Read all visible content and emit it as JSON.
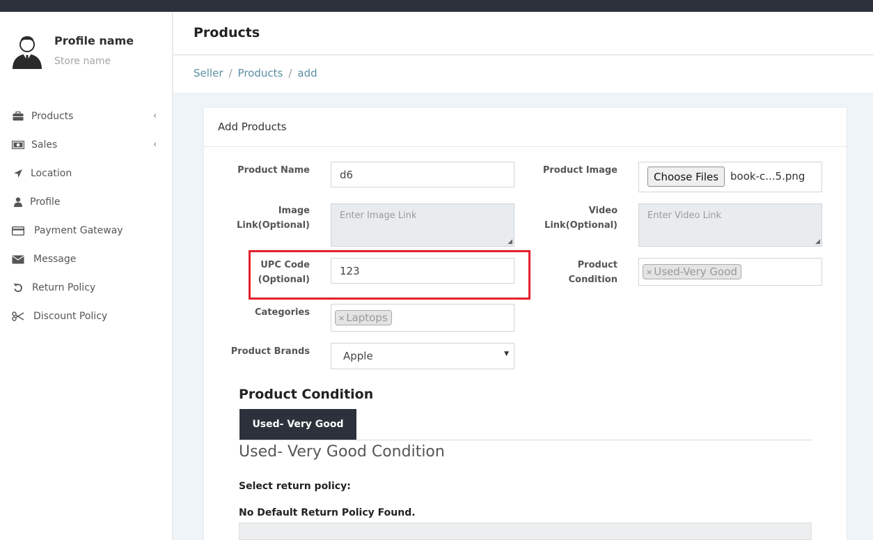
{
  "sidebar": {
    "profile_name": "Profile name",
    "store_name": "Store name",
    "items": [
      {
        "label": "Products",
        "icon": "briefcase-icon",
        "has_chevron": true
      },
      {
        "label": "Sales",
        "icon": "money-icon",
        "has_chevron": true
      },
      {
        "label": "Location",
        "icon": "location-arrow-icon",
        "has_chevron": false
      },
      {
        "label": "Profile",
        "icon": "user-icon",
        "has_chevron": false
      },
      {
        "label": "Payment Gateway",
        "icon": "credit-card-icon",
        "has_chevron": false
      },
      {
        "label": "Message",
        "icon": "envelope-icon",
        "has_chevron": false
      },
      {
        "label": "Return Policy",
        "icon": "undo-icon",
        "has_chevron": false
      },
      {
        "label": "Discount Policy",
        "icon": "scissors-icon",
        "has_chevron": false
      }
    ],
    "chevron": "‹"
  },
  "header": {
    "title": "Products"
  },
  "breadcrumb": {
    "items": [
      "Seller",
      "Products",
      "add"
    ],
    "separator": "/"
  },
  "card": {
    "title": "Add Products"
  },
  "form": {
    "product_name": {
      "label": "Product Name",
      "value": "d6"
    },
    "image_link": {
      "label_line1": "Image",
      "label_line2": "Link(Optional)",
      "placeholder": "Enter Image Link"
    },
    "upc_code": {
      "label_line1": "UPC Code",
      "label_line2": "(Optional)",
      "value": "123"
    },
    "categories": {
      "label": "Categories",
      "tag": "Laptops"
    },
    "product_brands": {
      "label": "Product Brands",
      "value": "Apple"
    },
    "product_image": {
      "label": "Product Image",
      "button": "Choose Files",
      "file_name": "book-c...5.png"
    },
    "video_link": {
      "label_line1": "Video",
      "label_line2": "Link(Optional)",
      "placeholder": "Enter Video Link"
    },
    "product_condition": {
      "label_line1": "Product",
      "label_line2": "Condition",
      "tag": "Used-Very Good"
    },
    "tag_remove": "×"
  },
  "condition_section": {
    "title": "Product Condition",
    "tab_label": "Used- Very Good",
    "description": "Used- Very Good Condition"
  },
  "return_policy": {
    "select_label": "Select return policy:",
    "empty_message": "No Default Return Policy Found."
  },
  "colors": {
    "topbar": "#2c313b",
    "accent_link": "#5b8fa3",
    "highlight": "#e3202a"
  }
}
